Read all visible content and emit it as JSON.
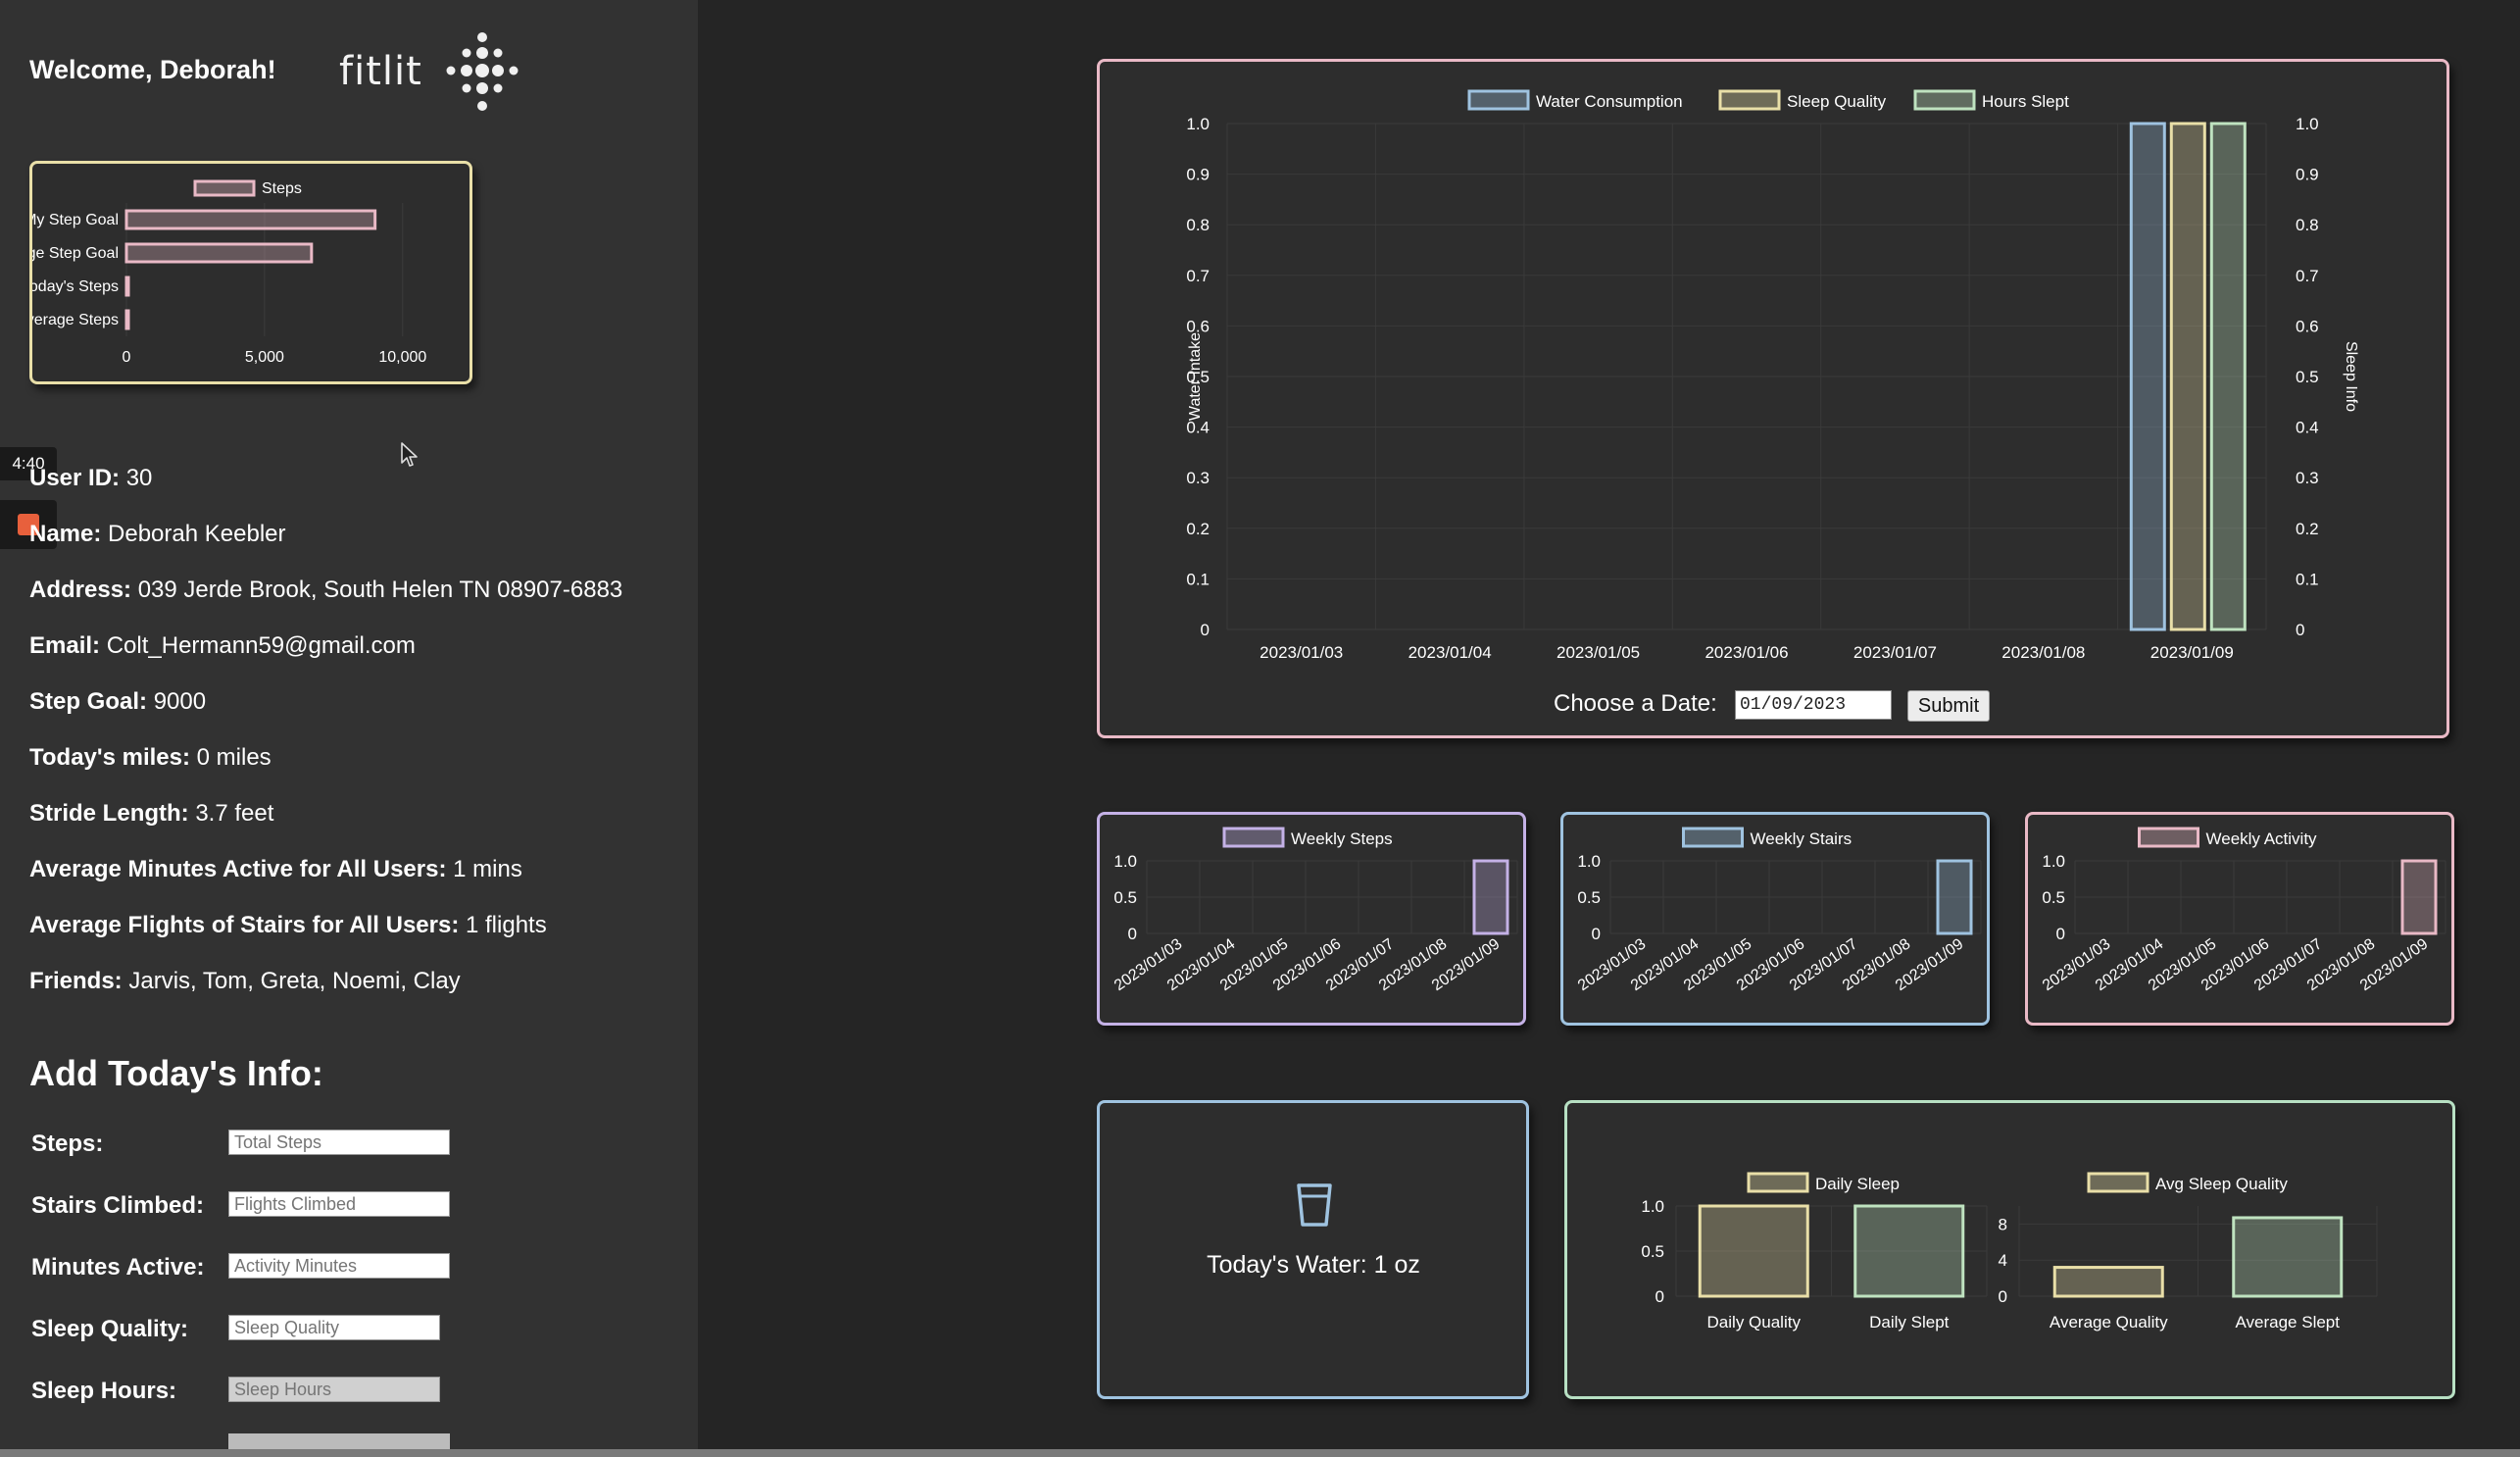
{
  "header": {
    "welcome": "Welcome, Deborah!",
    "brand": "fitlit"
  },
  "overlay": {
    "time": "4:40"
  },
  "user": {
    "id_label": "User ID:",
    "id": "30",
    "name_label": "Name:",
    "name": "Deborah Keebler",
    "address_label": "Address:",
    "address": "039 Jerde Brook, South Helen TN 08907-6883",
    "email_label": "Email:",
    "email": "Colt_Hermann59@gmail.com",
    "step_goal_label": "Step Goal:",
    "step_goal": "9000",
    "miles_label": "Today's miles:",
    "miles": "0 miles",
    "stride_label": "Stride Length:",
    "stride": "3.7 feet",
    "avg_min_label": "Average Minutes Active for All Users:",
    "avg_min": "1 mins",
    "avg_flights_label": "Average Flights of Stairs for All Users:",
    "avg_flights": "1 flights",
    "friends_label": "Friends:",
    "friends": "Jarvis, Tom, Greta, Noemi, Clay"
  },
  "form": {
    "title": "Add Today's Info:",
    "fields": [
      {
        "label": "Steps:",
        "placeholder": "Total Steps"
      },
      {
        "label": "Stairs Climbed:",
        "placeholder": "Flights Climbed"
      },
      {
        "label": "Minutes Active:",
        "placeholder": "Activity Minutes"
      },
      {
        "label": "Sleep Quality:",
        "placeholder": "Sleep Quality"
      },
      {
        "label": "Sleep Hours:",
        "placeholder": "Sleep Hours"
      }
    ]
  },
  "date_picker": {
    "label": "Choose a Date:",
    "value": "01/09/2023",
    "submit": "Submit"
  },
  "water": {
    "text": "Today's Water: 1 oz"
  },
  "colors": {
    "pink": "#e9b9c6",
    "blue": "#9fc3e0",
    "yellow": "#e9dfa8",
    "green": "#bfe3c0",
    "purple": "#c4b1e6",
    "mint": "#b7e0c3"
  },
  "chart_data": [
    {
      "id": "steps",
      "type": "bar",
      "orientation": "horizontal",
      "categories": [
        "My Step Goal",
        "Average Step Goal",
        "Today's Steps",
        "Average Steps"
      ],
      "series": [
        {
          "name": "Steps",
          "values": [
            9000,
            6700,
            0,
            0
          ]
        }
      ],
      "xlim": [
        0,
        11000
      ],
      "ticks": [
        "0",
        "5,000",
        "10,000"
      ]
    },
    {
      "id": "sleep-water",
      "type": "bar",
      "categories": [
        "2023/01/03",
        "2023/01/04",
        "2023/01/05",
        "2023/01/06",
        "2023/01/07",
        "2023/01/08",
        "2023/01/09"
      ],
      "series": [
        {
          "name": "Water Consumption",
          "values": [
            0,
            0,
            0,
            0,
            0,
            0,
            1
          ]
        },
        {
          "name": "Sleep Quality",
          "values": [
            0,
            0,
            0,
            0,
            0,
            0,
            1
          ]
        },
        {
          "name": "Hours Slept",
          "values": [
            0,
            0,
            0,
            0,
            0,
            0,
            1
          ]
        }
      ],
      "ylabel": "Water Intake",
      "y2label": "Sleep Info",
      "ylim": [
        0,
        1
      ],
      "ticks": [
        "0",
        "0.1",
        "0.2",
        "0.3",
        "0.4",
        "0.5",
        "0.6",
        "0.7",
        "0.8",
        "0.9",
        "1.0"
      ]
    },
    {
      "id": "weekly-steps",
      "type": "bar",
      "categories": [
        "2023/01/03",
        "2023/01/04",
        "2023/01/05",
        "2023/01/06",
        "2023/01/07",
        "2023/01/08",
        "2023/01/09"
      ],
      "series": [
        {
          "name": "Weekly Steps",
          "values": [
            0,
            0,
            0,
            0,
            0,
            0,
            1
          ]
        }
      ],
      "ylim": [
        0,
        1
      ],
      "ticks": [
        "0",
        "0.5",
        "1.0"
      ]
    },
    {
      "id": "weekly-stairs",
      "type": "bar",
      "categories": [
        "2023/01/03",
        "2023/01/04",
        "2023/01/05",
        "2023/01/06",
        "2023/01/07",
        "2023/01/08",
        "2023/01/09"
      ],
      "series": [
        {
          "name": "Weekly Stairs",
          "values": [
            0,
            0,
            0,
            0,
            0,
            0,
            1
          ]
        }
      ],
      "ylim": [
        0,
        1
      ],
      "ticks": [
        "0",
        "0.5",
        "1.0"
      ]
    },
    {
      "id": "weekly-activity",
      "type": "bar",
      "categories": [
        "2023/01/03",
        "2023/01/04",
        "2023/01/05",
        "2023/01/06",
        "2023/01/07",
        "2023/01/08",
        "2023/01/09"
      ],
      "series": [
        {
          "name": "Weekly Activity",
          "values": [
            0,
            0,
            0,
            0,
            0,
            0,
            1
          ]
        }
      ],
      "ylim": [
        0,
        1
      ],
      "ticks": [
        "0",
        "0.5",
        "1.0"
      ]
    },
    {
      "id": "daily-sleep",
      "type": "bar",
      "categories": [
        "Daily Quality",
        "Daily Slept"
      ],
      "series": [
        {
          "name": "Daily Sleep",
          "values": [
            1,
            1
          ]
        }
      ],
      "ylim": [
        0,
        1
      ],
      "ticks": [
        "0",
        "0.5",
        "1.0"
      ]
    },
    {
      "id": "avg-sleep",
      "type": "bar",
      "categories": [
        "Average Quality",
        "Average Slept"
      ],
      "series": [
        {
          "name": "Avg Sleep Quality",
          "values": [
            3.2,
            8.7
          ]
        }
      ],
      "ylim": [
        0,
        10
      ],
      "ticks": [
        "0",
        "4",
        "8"
      ]
    }
  ]
}
